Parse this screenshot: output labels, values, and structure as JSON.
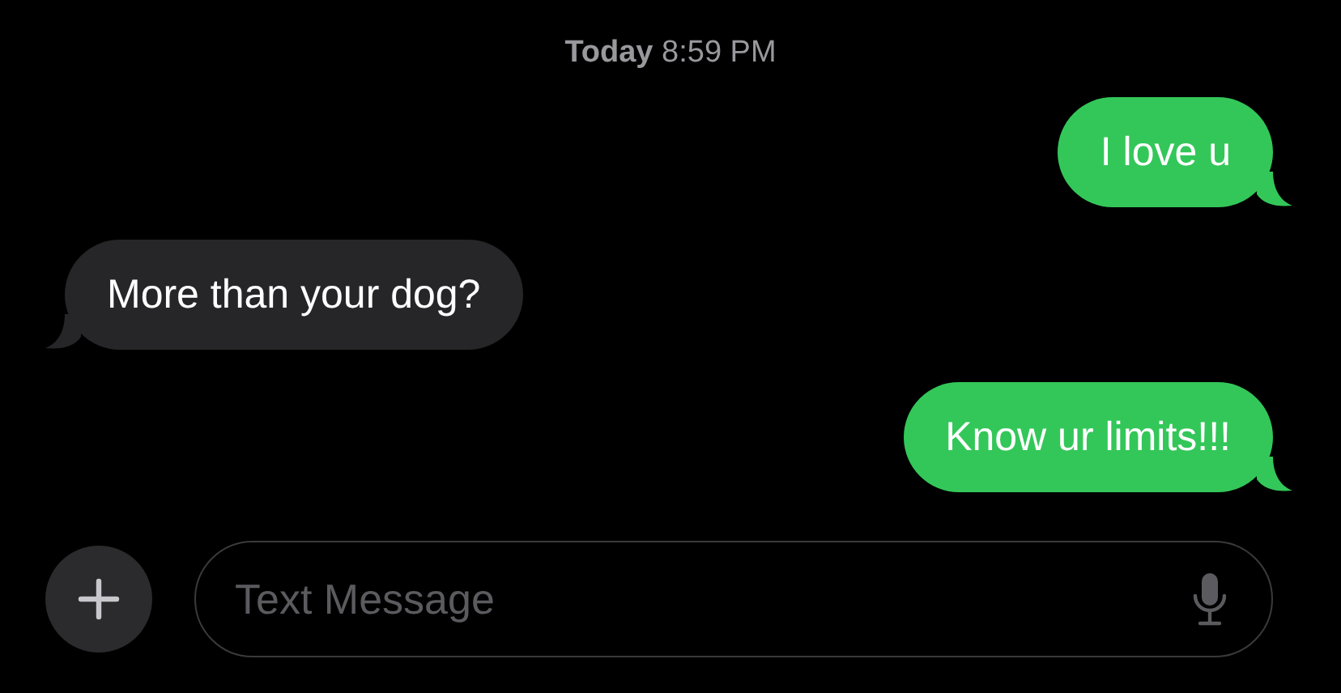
{
  "timestamp": "**Today** 8:59 PM",
  "messages": [
    {
      "kind": "sent",
      "text": "I love u"
    },
    {
      "kind": "received",
      "text": "More than your dog?"
    },
    {
      "kind": "sent",
      "text": "Know ur limits!!!"
    }
  ],
  "composer": {
    "placeholder": "Text Message"
  }
}
